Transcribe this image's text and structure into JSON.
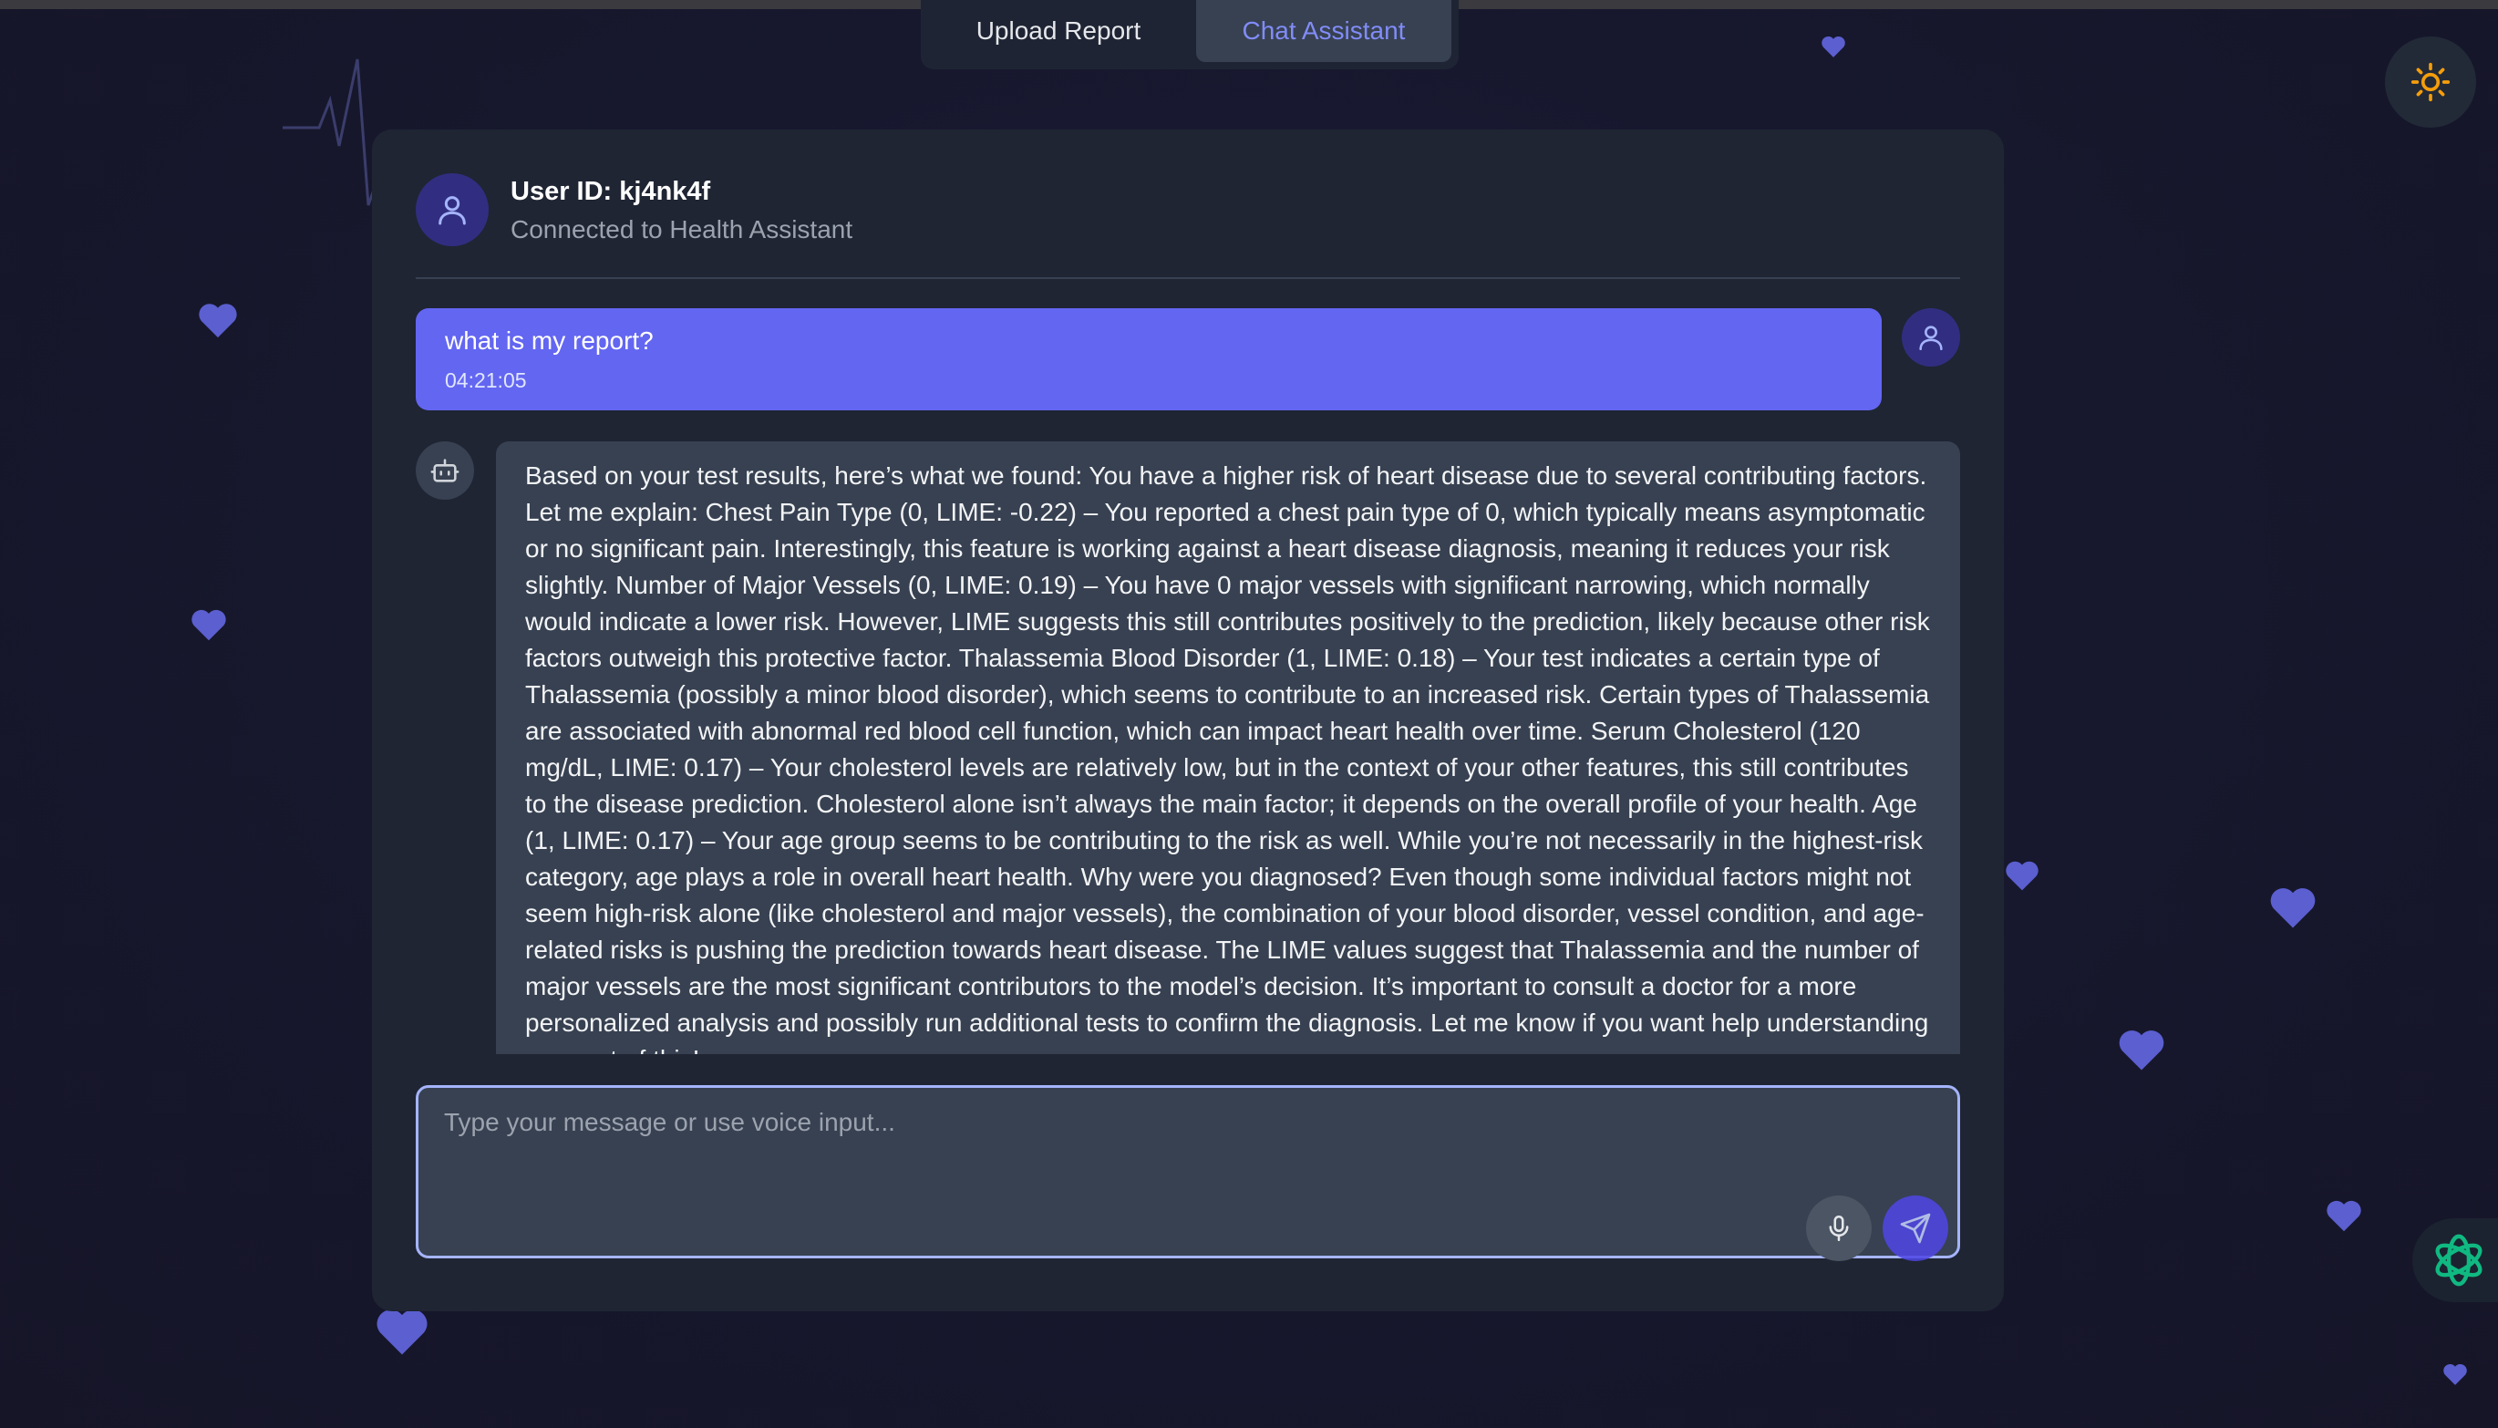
{
  "tabs": [
    {
      "label": "Upload Report",
      "active": false
    },
    {
      "label": "Chat Assistant",
      "active": true
    }
  ],
  "header": {
    "user_id": "User ID: kj4nk4f",
    "status": "Connected to Health Assistant"
  },
  "messages": [
    {
      "role": "user",
      "text": "what is my report?",
      "time": "04:21:05"
    },
    {
      "role": "assistant",
      "text": "Based on your test results, here’s what we found: You have a higher risk of heart disease due to several contributing factors. Let me explain: Chest Pain Type (0, LIME: -0.22) – You reported a chest pain type of 0, which typically means asymptomatic or no significant pain. Interestingly, this feature is working against a heart disease diagnosis, meaning it reduces your risk slightly. Number of Major Vessels (0, LIME: 0.19) – You have 0 major vessels with significant narrowing, which normally would indicate a lower risk. However, LIME suggests this still contributes positively to the prediction, likely because other risk factors outweigh this protective factor. Thalassemia Blood Disorder (1, LIME: 0.18) – Your test indicates a certain type of Thalassemia (possibly a minor blood disorder), which seems to contribute to an increased risk. Certain types of Thalassemia are associated with abnormal red blood cell function, which can impact heart health over time. Serum Cholesterol (120 mg/dL, LIME: 0.17) – Your cholesterol levels are relatively low, but in the context of your other features, this still contributes to the disease prediction. Cholesterol alone isn’t always the main factor; it depends on the overall profile of your health. Age (1, LIME: 0.17) – Your age group seems to be contributing to the risk as well. While you’re not necessarily in the highest-risk category, age plays a role in overall heart health. Why were you diagnosed? Even though some individual factors might not seem high-risk alone (like cholesterol and major vessels), the combination of your blood disorder, vessel condition, and age-related risks is pushing the prediction towards heart disease. The LIME values suggest that Thalassemia and the number of major vessels are the most significant contributors to the model’s decision. It’s important to consult a doctor for a more personalized analysis and possibly run additional tests to confirm the diagnosis. Let me know if you want help understanding any part of this!"
    }
  ],
  "input": {
    "placeholder": "Type your message or use voice input...",
    "value": ""
  },
  "icons": {
    "theme": "sun-icon",
    "user": "user-icon",
    "bot": "bot-icon",
    "mic": "microphone-icon",
    "send": "send-icon",
    "assistant_logo": "openai-logo-icon",
    "decoration": "heart-icon"
  },
  "colors": {
    "accent": "#6366f1",
    "active_tab_text": "#818cf8",
    "sun": "#f59e0b",
    "logo": "#10b981",
    "heart": "#5b5fd0"
  }
}
